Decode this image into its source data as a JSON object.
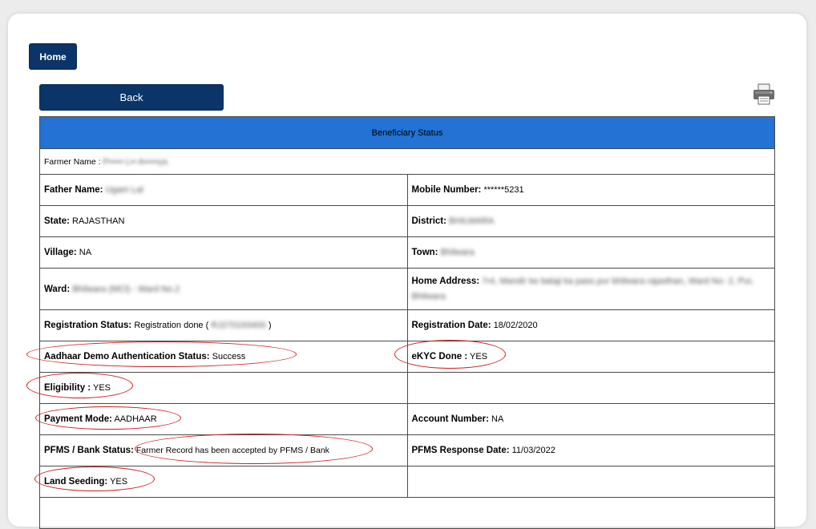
{
  "nav": {
    "home_label": "Home",
    "back_label": "Back",
    "print_icon": "printer-icon"
  },
  "table": {
    "title": "Beneficiary Status",
    "farmer_label": "Farmer Name :",
    "farmer_value": "P••••• L•• A•••••ya",
    "father_label": "Father Name:",
    "father_value": "Ugam Lal",
    "mobile_label": "Mobile Number:",
    "mobile_value": "******5231",
    "state_label": "State:",
    "state_value": "RAJASTHAN",
    "district_label": "District:",
    "district_value": "BHILWARA",
    "village_label": "Village:",
    "village_value": "NA",
    "town_label": "Town:",
    "town_value": "Bhilwara",
    "ward_label": "Ward:",
    "ward_value": "Bhilwara (MCl) - Ward No.2",
    "address_label": "Home Address:",
    "address_value": "7•4, Mandir ke balaji ka pass pur bhilwara rajasthan, Ward No- 2, Pur, Bhilwara",
    "reg_status_label": "Registration Status:",
    "reg_status_value": "Registration done (",
    "reg_status_id": "RJ270193400",
    "reg_status_close": ")",
    "reg_date_label": "Registration Date:",
    "reg_date_value": "18/02/2020",
    "aadhaar_label": "Aadhaar Demo Authentication Status:",
    "aadhaar_value": "Success",
    "ekyc_label": "eKYC Done :",
    "ekyc_value": "YES",
    "eligibility_label": "Eligibility :",
    "eligibility_value": "YES",
    "payment_label": "Payment Mode:",
    "payment_value": "AADHAAR",
    "account_label": "Account Number:",
    "account_value": "NA",
    "pfms_label": "PFMS / Bank Status:",
    "pfms_value": "Farmer Record has been accepted by PFMS / Bank",
    "pfms_date_label": "PFMS Response Date:",
    "pfms_date_value": "11/03/2022",
    "land_label": "Land Seeding:",
    "land_value": "YES"
  },
  "colors": {
    "button_bg": "#0b3468",
    "header_bg": "#2372d4",
    "annotation": "#cc1a1a"
  }
}
